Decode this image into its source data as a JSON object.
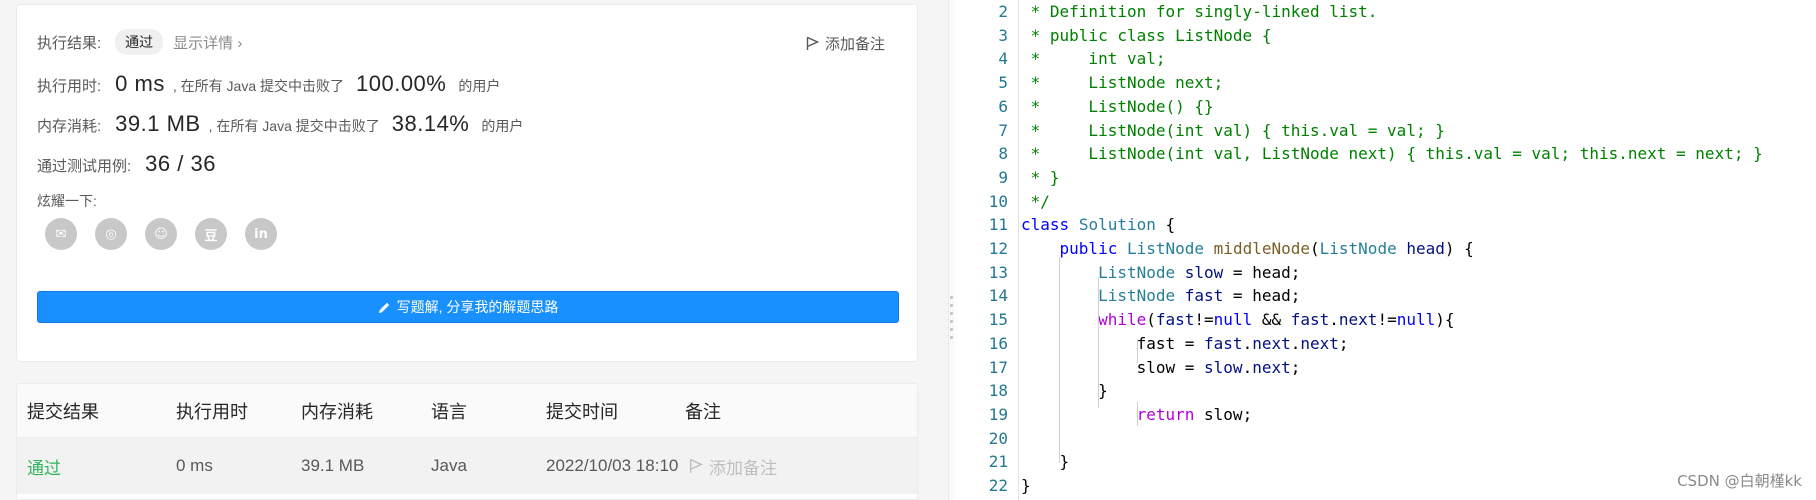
{
  "result": {
    "label": "执行结果:",
    "status": "通过",
    "details": "显示详情 ›",
    "add_note": "添加备注"
  },
  "runtime": {
    "label": "执行用时:",
    "value": "0 ms",
    "beat_text": ", 在所有 Java 提交中击败了",
    "percent": "100.00%",
    "users": "的用户"
  },
  "memory": {
    "label": "内存消耗:",
    "value": "39.1 MB",
    "beat_text": ", 在所有 Java 提交中击败了",
    "percent": "38.14%",
    "users": "的用户"
  },
  "testcases": {
    "label": "通过测试用例:",
    "value": "36 / 36"
  },
  "share": {
    "label": "炫耀一下:",
    "icons": [
      "wechat-icon",
      "weibo-icon",
      "qq-icon",
      "douban-icon",
      "linkedin-icon"
    ],
    "glyphs": [
      "✉",
      "◎",
      "☺",
      "豆",
      "in"
    ]
  },
  "write_solution": "写题解, 分享我的解题思路",
  "table": {
    "headers": [
      "提交结果",
      "执行用时",
      "内存消耗",
      "语言",
      "提交时间",
      "备注"
    ],
    "row": {
      "result": "通过",
      "runtime": "0 ms",
      "memory": "39.1 MB",
      "language": "Java",
      "time": "2022/10/03 18:10",
      "note": "添加备注"
    }
  },
  "colors": {
    "accent": "#1890ff",
    "pass_green": "#2db55d",
    "comment_green": "#008000",
    "keyword_blue": "#0000ff"
  },
  "code": {
    "line_numbers": [
      "2",
      "3",
      "4",
      "5",
      "6",
      "7",
      "8",
      "9",
      "10",
      "11",
      "12",
      "13",
      "14",
      "15",
      "16",
      "17",
      "18",
      "19",
      "20",
      "21",
      "22"
    ],
    "lines": [
      " * Definition for singly-linked list.",
      " * public class ListNode {",
      " *     int val;",
      " *     ListNode next;",
      " *     ListNode() {}",
      " *     ListNode(int val) { this.val = val; }",
      " *     ListNode(int val, ListNode next) { this.val = val; this.next = next; }",
      " * }",
      " */",
      "class Solution {",
      "    public ListNode middleNode(ListNode head) {",
      "        ListNode slow = head;",
      "        ListNode fast = head;",
      "        while(fast!=null && fast.next!=null){",
      "            fast = fast.next.next;",
      "            slow = slow.next;",
      "        }",
      "            return slow;",
      "",
      "    }",
      "}"
    ]
  },
  "watermark": "CSDN @白朝槿kk"
}
